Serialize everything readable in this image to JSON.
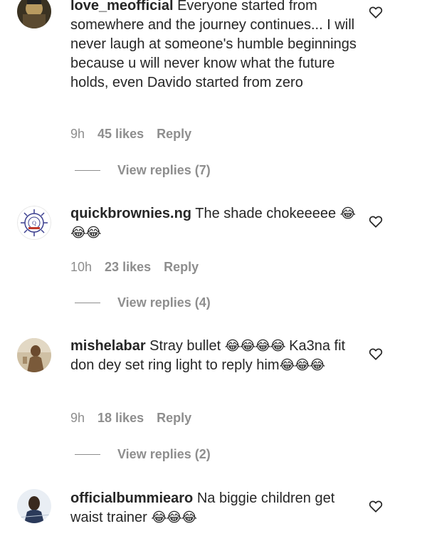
{
  "comments": [
    {
      "username": "love_meofficial",
      "text": "Everyone started from somewhere and the journey continues... I will never laugh at someone's humble beginnings because u will never know what the future holds, even Davido started from zero",
      "emojis": "",
      "time": "9h",
      "likes": "45 likes",
      "reply": "Reply",
      "view_replies": "View replies (7)"
    },
    {
      "username": "quickbrownies.ng",
      "text": "The shade chokeeeee",
      "emojis": "😂😂😂",
      "time": "10h",
      "likes": "23 likes",
      "reply": "Reply",
      "view_replies": "View replies (4)"
    },
    {
      "username": "mishelabar",
      "text_a": "Stray bullet",
      "emojis_a": "😂😂😂😂",
      "text_b": "Ka3na fit don dey set ring light to reply him",
      "emojis_b": "😂😂😂",
      "time": "9h",
      "likes": "18 likes",
      "reply": "Reply",
      "view_replies": "View replies (2)"
    },
    {
      "username": "officialbummiearo",
      "text": "Na biggie children get waist trainer",
      "emojis": "😂😂😂"
    }
  ],
  "colors": {
    "text": "#262626",
    "muted": "#8e8e8e"
  },
  "icons": {
    "like": "heart-outline-icon"
  }
}
